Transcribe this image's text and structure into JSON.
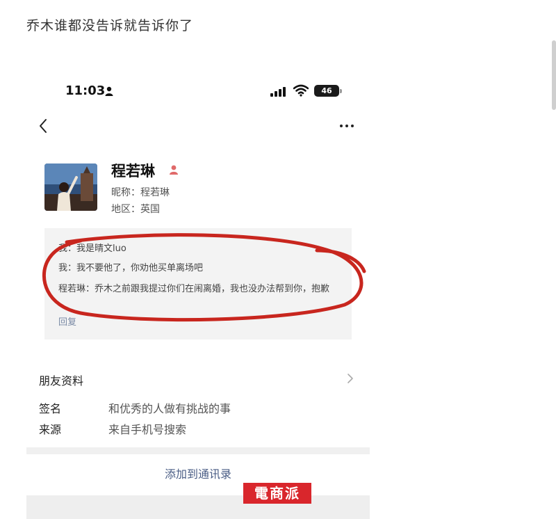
{
  "caption": "乔木谁都没告诉就告诉你了",
  "status_bar": {
    "time": "11:03",
    "battery": "46"
  },
  "profile": {
    "name": "程若琳",
    "nickname": "昵称：程若琳",
    "region": "地区：英国"
  },
  "messages": [
    {
      "text": "我：我是晴文luo"
    },
    {
      "text": "我：我不要他了，你劝他买单离场吧"
    },
    {
      "text": "程若琳：乔木之前跟我提过你们在闹离婚，我也没办法帮到你，抱歉"
    }
  ],
  "reply_label": "回复",
  "friend_info_label": "朋友资料",
  "fields": {
    "signature": {
      "key": "签名",
      "value": "和优秀的人做有挑战的事"
    },
    "source": {
      "key": "来源",
      "value": "来自手机号搜索"
    }
  },
  "add_contact_label": "添加到通讯录",
  "watermark": "電商派",
  "colors": {
    "circle_annotation": "#c8261e",
    "link": "#4a5d85",
    "watermark_bg": "#d9262c"
  }
}
